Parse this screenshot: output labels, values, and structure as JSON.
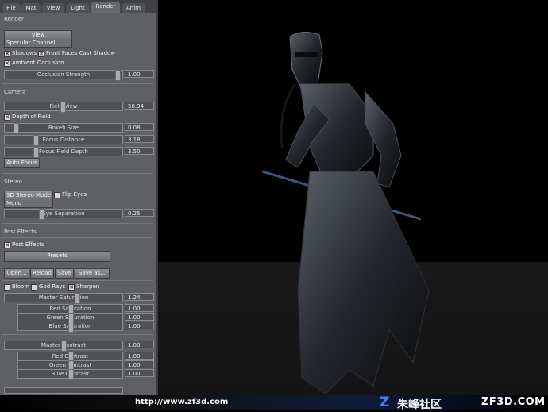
{
  "tabs": [
    "File",
    "Mat",
    "View",
    "Light",
    "Render",
    "Anim"
  ],
  "active_tab": "Render",
  "render": {
    "section": "Render",
    "view_label": "View",
    "view_value": "Specular Channel",
    "shadows": "Shadows",
    "front_faces": "Front Faces Cast Shadow",
    "ambient_occlusion": "Ambient Occlusion",
    "occlusion_strength": {
      "label": "Occlusion Strength",
      "value": "1.00",
      "level": 0.98
    }
  },
  "camera": {
    "section": "Camera",
    "field_of_view": {
      "label": "Field   View",
      "value": "58.94",
      "level": 0.49
    },
    "depth_of_field": "Depth of Field",
    "bokeh_size": {
      "label": "Bokeh Size",
      "value": "0.08",
      "level": 0.08
    },
    "focus_distance": {
      "label": "Focus Distance",
      "value": "3.18",
      "level": 0.25
    },
    "focus_field_depth": {
      "label": "Focus Field Depth",
      "value": "3.50",
      "level": 0.25
    },
    "auto_focus": "Auto Focus"
  },
  "stereo": {
    "section": "Stereo",
    "mode_label": "3D Stereo Mode",
    "mode_value": "Mono",
    "flip_eyes": "Flip Eyes",
    "eye_separation": {
      "label": "Eye Separation",
      "value": "0.25",
      "level": 0.3
    }
  },
  "post": {
    "section": "Post Effects",
    "post_effects": "Post Effects",
    "presets": "Presets",
    "open": "Open...",
    "reload": "Reload",
    "save": "Save",
    "save_as": "Save as...",
    "bloom": "Bloom",
    "god_rays": "God Rays",
    "sharpen": "Sharpen",
    "master_saturation": {
      "label": "Master Saturation",
      "value": "1.24",
      "level": 0.62
    },
    "red_saturation": {
      "label": "Red Saturation",
      "value": "1.00",
      "level": 0.5
    },
    "green_saturation": {
      "label": "Green Saturation",
      "value": "1.00",
      "level": 0.5
    },
    "blue_saturation": {
      "label": "Blue Saturation",
      "value": "1.00",
      "level": 0.5
    },
    "master_contrast": {
      "label": "Master Contrast",
      "value": "1.00",
      "level": 0.5
    },
    "red_contrast": {
      "label": "Red Contrast",
      "value": "1.00",
      "level": 0.5
    },
    "green_contrast": {
      "label": "Green Contrast",
      "value": "1.00",
      "level": 0.5
    },
    "blue_contrast": {
      "label": "Blue Contrast",
      "value": "1.00",
      "level": 0.5
    }
  },
  "footer": {
    "url": "http://www.zf3d.com",
    "brand_cn": "朱峰社区",
    "brand_site": "ZF3D.COM"
  }
}
